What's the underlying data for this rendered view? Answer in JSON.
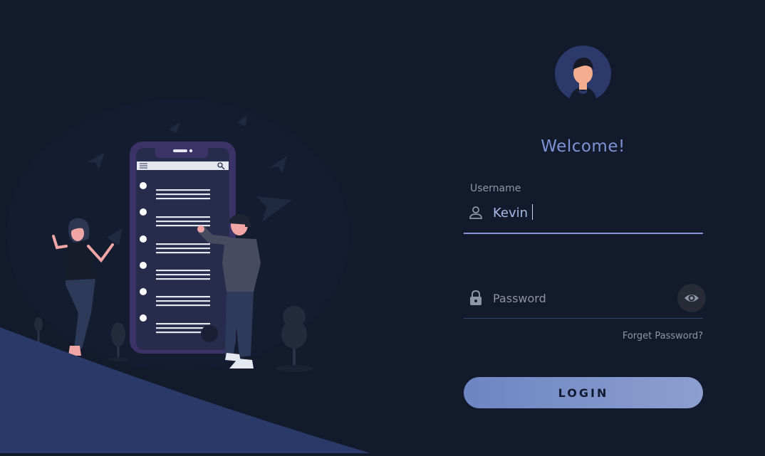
{
  "login": {
    "welcome": "Welcome!",
    "username_label": "Username",
    "username_value": "Kevin",
    "password_placeholder": "Password",
    "forgot_label": "Forget Password?",
    "login_label": "LOGIN"
  },
  "icons": {
    "user": "person-outline-icon",
    "password": "lock-icon",
    "toggle": "eye-icon"
  },
  "colors": {
    "background": "#131a2c",
    "accent": "#7d93d6",
    "button": "#7d93cc",
    "wave": "#2a3a68"
  }
}
